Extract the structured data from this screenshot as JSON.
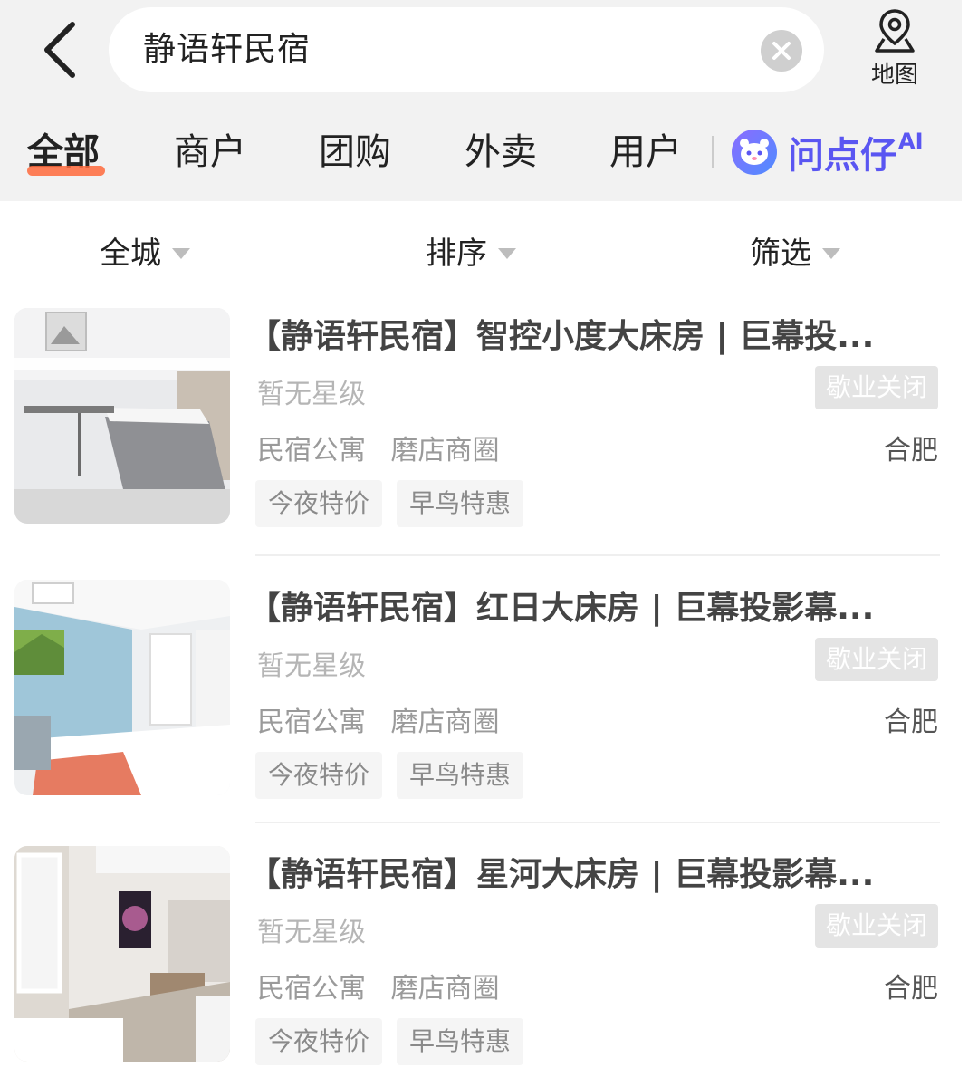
{
  "header": {
    "search_value": "静语轩民宿",
    "map_label": "地图"
  },
  "tabs": [
    {
      "label": "全部",
      "active": true
    },
    {
      "label": "商户",
      "active": false
    },
    {
      "label": "团购",
      "active": false
    },
    {
      "label": "外卖",
      "active": false
    },
    {
      "label": "用户",
      "active": false
    }
  ],
  "ai_tab": {
    "label": "问点仔",
    "sup": "AI"
  },
  "filters": {
    "area": "全城",
    "sort": "排序",
    "filter": "筛选"
  },
  "listings": [
    {
      "title": "【静语轩民宿】智控小度大床房 | 巨幕投...",
      "rating": "暂无星级",
      "status": "歇业关闭",
      "category": "民宿公寓",
      "area": "磨店商圈",
      "city": "合肥",
      "tags": [
        "今夜特价",
        "早鸟特惠"
      ]
    },
    {
      "title": "【静语轩民宿】红日大床房 | 巨幕投影幕...",
      "rating": "暂无星级",
      "status": "歇业关闭",
      "category": "民宿公寓",
      "area": "磨店商圈",
      "city": "合肥",
      "tags": [
        "今夜特价",
        "早鸟特惠"
      ]
    },
    {
      "title": "【静语轩民宿】星河大床房 | 巨幕投影幕...",
      "rating": "暂无星级",
      "status": "歇业关闭",
      "category": "民宿公寓",
      "area": "磨店商圈",
      "city": "合肥",
      "tags": [
        "今夜特价",
        "早鸟特惠"
      ]
    }
  ],
  "colors": {
    "accent": "#ff6a3c",
    "ai": "#5a56f2",
    "header_bg": "#f2f2f2"
  }
}
